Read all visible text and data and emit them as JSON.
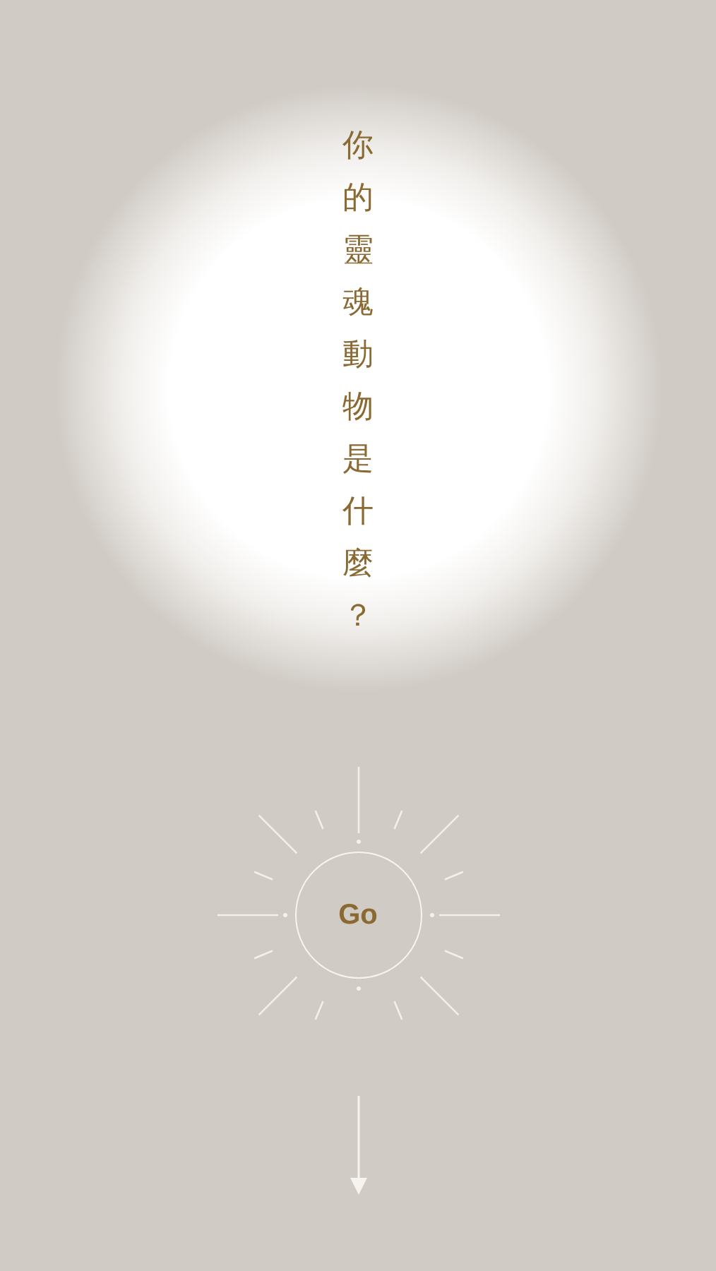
{
  "title": "你的靈魂動物是什麼？",
  "go_button": {
    "label": "Go"
  }
}
